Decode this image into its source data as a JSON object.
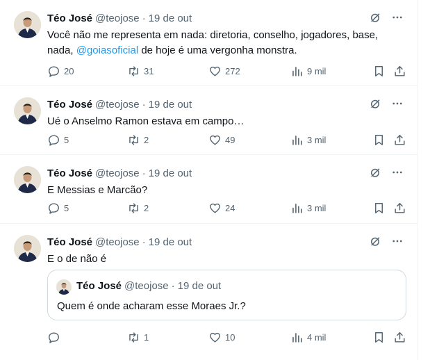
{
  "tweets": [
    {
      "name": "Téo José",
      "handle": "@teojose",
      "date": "19 de out",
      "text_before": "Você não me representa em nada: diretoria, conselho, jogadores, base, nada,  ",
      "mention": "@goiasoficial",
      "text_after": " de hoje é uma vergonha monstra.",
      "replies": "20",
      "retweets": "31",
      "likes": "272",
      "views": "9 mil"
    },
    {
      "name": "Téo José",
      "handle": "@teojose",
      "date": "19 de out",
      "text": "Ué o Anselmo Ramon estava em campo…",
      "replies": "5",
      "retweets": "2",
      "likes": "49",
      "views": "3 mil"
    },
    {
      "name": "Téo José",
      "handle": "@teojose",
      "date": "19 de out",
      "text": "E Messias e Marcão?",
      "replies": "5",
      "retweets": "2",
      "likes": "24",
      "views": "3 mil"
    },
    {
      "name": "Téo José",
      "handle": "@teojose",
      "date": "19 de out",
      "text": "E o de não é",
      "replies": "",
      "retweets": "1",
      "likes": "10",
      "views": "4 mil",
      "quote": {
        "name": "Téo José",
        "handle": "@teojose",
        "date": "19 de out",
        "text": "Quem é onde acharam esse Moraes Jr.?"
      }
    }
  ],
  "separator": "·",
  "icons": {
    "grok": "grok-icon",
    "more": "more-icon",
    "reply": "reply-icon",
    "retweet": "retweet-icon",
    "like": "like-icon",
    "views": "views-icon",
    "bookmark": "bookmark-icon",
    "share": "share-icon"
  },
  "colors": {
    "text": "#0f1419",
    "secondary": "#536471",
    "mention": "#1d9bf0",
    "border": "#eff3f4",
    "quote_border": "#cfd9de"
  }
}
